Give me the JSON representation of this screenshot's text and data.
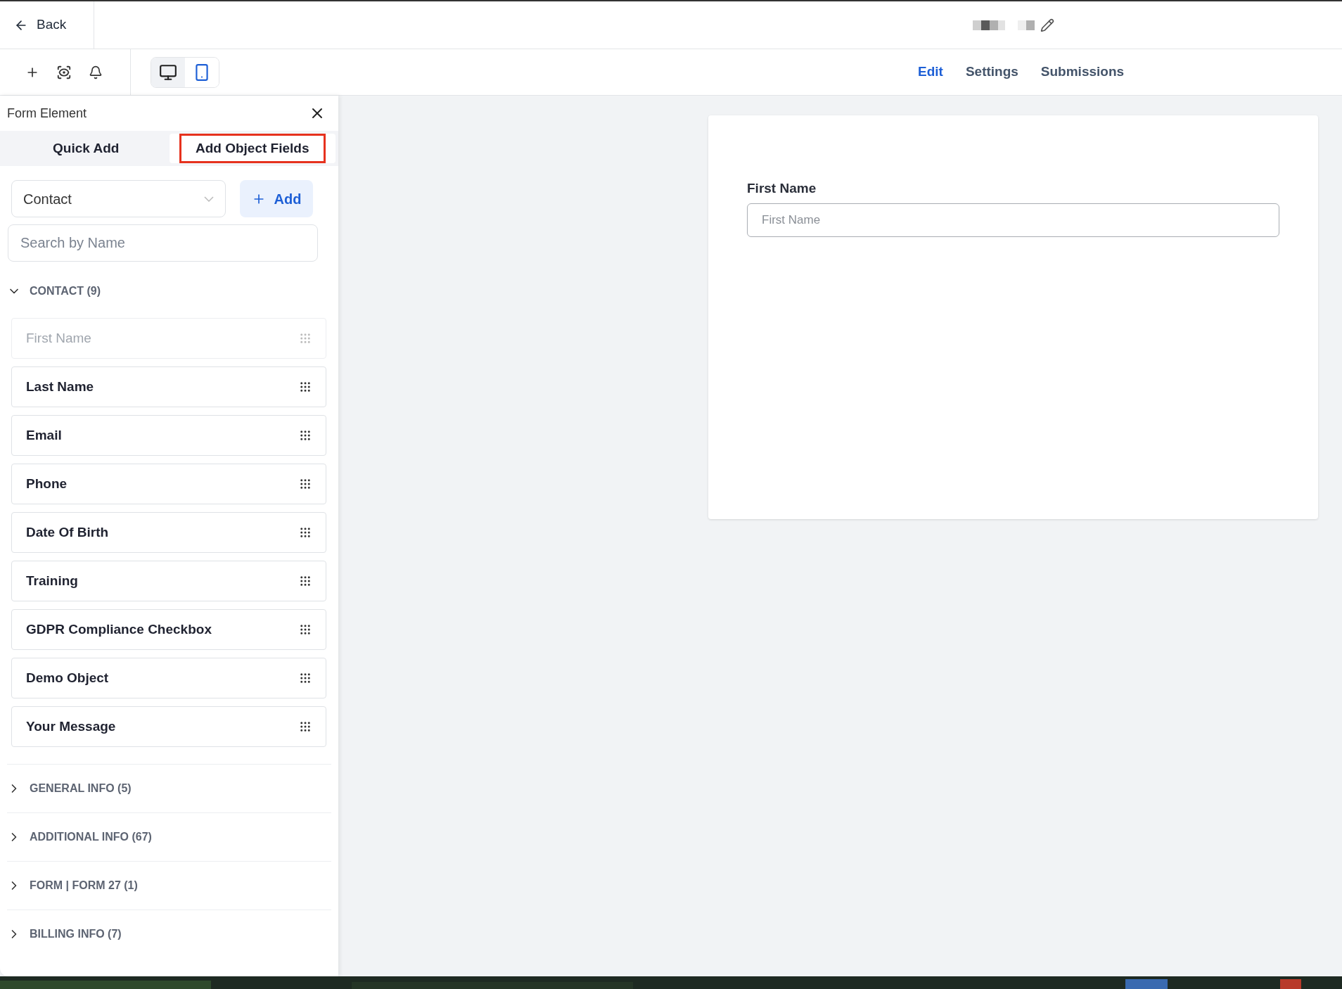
{
  "header": {
    "back": "Back"
  },
  "toolbar": {
    "devices": [
      {
        "kind": "desktop",
        "selected": false
      },
      {
        "kind": "mobile",
        "selected": true
      }
    ]
  },
  "nav_tabs": [
    {
      "label": "Edit",
      "selected": true
    },
    {
      "label": "Settings",
      "selected": false
    },
    {
      "label": "Submissions",
      "selected": false
    }
  ],
  "panel": {
    "title": "Form Element",
    "tabs": [
      {
        "label": "Quick Add",
        "selected": false,
        "highlighted": false
      },
      {
        "label": "Add Object Fields",
        "selected": true,
        "highlighted": true
      }
    ],
    "object_select": {
      "value": "Contact"
    },
    "add_button": "Add",
    "search": {
      "placeholder": "Search by Name"
    },
    "sections": [
      {
        "title": "CONTACT (9)",
        "expanded": true,
        "fields": [
          {
            "label": "First Name",
            "disabled": true
          },
          {
            "label": "Last Name",
            "disabled": false
          },
          {
            "label": "Email",
            "disabled": false
          },
          {
            "label": "Phone",
            "disabled": false
          },
          {
            "label": "Date Of Birth",
            "disabled": false
          },
          {
            "label": "Training",
            "disabled": false
          },
          {
            "label": "GDPR Compliance Checkbox",
            "disabled": false
          },
          {
            "label": "Demo Object",
            "disabled": false
          },
          {
            "label": "Your Message",
            "disabled": false
          }
        ]
      },
      {
        "title": "GENERAL INFO (5)",
        "expanded": false
      },
      {
        "title": "ADDITIONAL INFO (67)",
        "expanded": false
      },
      {
        "title": "FORM | FORM 27 (1)",
        "expanded": false
      },
      {
        "title": "BILLING INFO (7)",
        "expanded": false
      }
    ]
  },
  "canvas": {
    "field": {
      "label": "First Name",
      "placeholder": "First Name"
    }
  }
}
